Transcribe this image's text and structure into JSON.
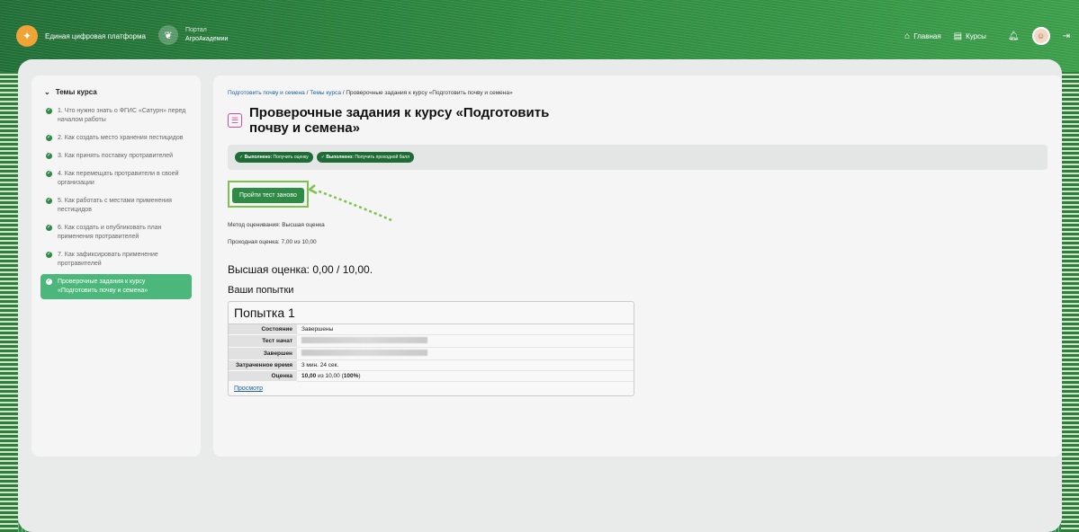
{
  "header": {
    "brand_name": "Единая цифровая платформа",
    "portal_line1": "Портал",
    "portal_line2": "АгроАкадемии",
    "nav": [
      {
        "label": "Главная",
        "icon": "home-icon"
      },
      {
        "label": "Курсы",
        "icon": "courses-icon"
      }
    ]
  },
  "sidebar": {
    "title": "Темы курса",
    "items": [
      {
        "label": "1. Что нужно знать о ФГИС «Сатурн» перед началом работы"
      },
      {
        "label": "2. Как создать место хранения пестицидов"
      },
      {
        "label": "3. Как принять поставку протравителей"
      },
      {
        "label": "4. Как перемещать протравители в своей организации"
      },
      {
        "label": "5. Как работать с местами применения пестицидов"
      },
      {
        "label": "6. Как создать и опубликовать план применения протравителей"
      },
      {
        "label": "7. Как зафиксировать применение протравителей"
      },
      {
        "label": "Проверочные задания к курсу «Подготовить почву и семена»"
      }
    ]
  },
  "breadcrumb": {
    "item1": "Подготовить почву и семена",
    "item2": "Темы курса",
    "item3": "Проверочные задания к курсу «Подготовить почву и семена»",
    "sep": "/"
  },
  "main": {
    "title": "Проверочные задания к курсу «Подготовить почву и семена»",
    "badges": [
      {
        "prefix": "Выполнено:",
        "text": "Получить оценку"
      },
      {
        "prefix": "Выполнено:",
        "text": "Получить проходной балл"
      }
    ],
    "retry_label": "Пройти тест заново",
    "grading_method": "Метод оценивания: Высшая оценка",
    "passing_grade": "Проходная оценка: 7,00 из 10,00",
    "highest_grade": "Высшая оценка: 0,00 / 10,00.",
    "attempts_title": "Ваши попытки"
  },
  "attempt": {
    "title": "Попытка 1",
    "rows": [
      {
        "label": "Состояние",
        "value": "Завершены"
      },
      {
        "label": "Тест начат",
        "value": ""
      },
      {
        "label": "Завершен",
        "value": ""
      },
      {
        "label": "Затраченное время",
        "value": "3 мин. 24 сек."
      },
      {
        "label": "Оценка",
        "value_bold": "10,00",
        "value_mid": " из 10,00 (",
        "value_pct": "100%",
        "value_end": ")"
      }
    ],
    "view_link": "Просмотр"
  }
}
